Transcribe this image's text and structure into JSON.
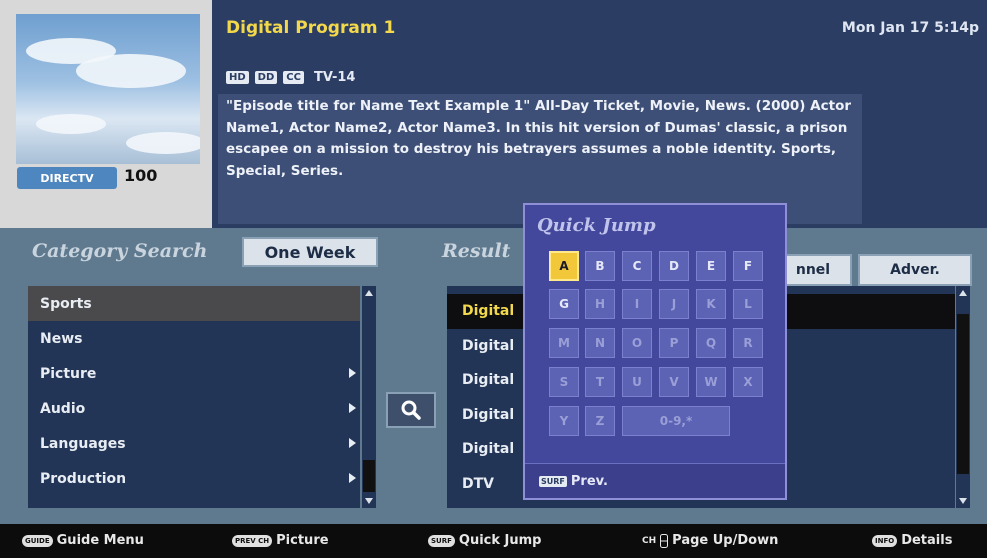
{
  "channel": {
    "brand": "DIRECTV",
    "number": "100"
  },
  "program": {
    "title": "Digital Program 1",
    "datetime": "Mon Jan 17  5:14p",
    "tags": [
      "HD",
      "DD",
      "CC"
    ],
    "rating": "TV-14",
    "description": "\"Episode title for Name Text Example 1\" All-Day Ticket, Movie, News. (2000) Actor Name1, Actor Name2, Actor Name3. In this hit version of Dumas' classic, a prison escapee on a mission to destroy his betrayers assumes a noble identity. Sports, Special, Series."
  },
  "category_search": {
    "heading": "Category Search",
    "time_range": "One Week",
    "items": [
      {
        "label": "Sports"
      },
      {
        "label": "News"
      },
      {
        "label": "Picture"
      },
      {
        "label": "Audio"
      },
      {
        "label": "Languages"
      },
      {
        "label": "Production"
      }
    ]
  },
  "results": {
    "heading": "Result",
    "columns": [
      "nnel",
      "Adver."
    ],
    "items": [
      "Digital",
      "Digital",
      "Digital",
      "Digital",
      "Digital",
      "DTV"
    ]
  },
  "quick_jump": {
    "title": "Quick Jump",
    "selected_key": "A",
    "rows": [
      [
        "A",
        "B",
        "C",
        "D",
        "E",
        "F"
      ],
      [
        "G",
        "H",
        "I",
        "J",
        "K",
        "L"
      ],
      [
        "M",
        "N",
        "O",
        "P",
        "Q",
        "R"
      ],
      [
        "S",
        "T",
        "U",
        "V",
        "W",
        "X"
      ],
      [
        "Y",
        "Z",
        "0-9,*"
      ]
    ],
    "enabled_keys": [
      "A",
      "B",
      "C",
      "D",
      "E",
      "F",
      "G"
    ],
    "footer_button": "SURF",
    "footer_label": "Prev."
  },
  "bottom_bar": {
    "hints": [
      {
        "key": "GUIDE",
        "label": "Guide Menu"
      },
      {
        "key": "PREV CH",
        "label": "Picture"
      },
      {
        "key": "SURF",
        "label": "Quick Jump"
      },
      {
        "key": "CH",
        "label": "Page Up/Down"
      },
      {
        "key": "INFO",
        "label": "Details"
      }
    ]
  }
}
